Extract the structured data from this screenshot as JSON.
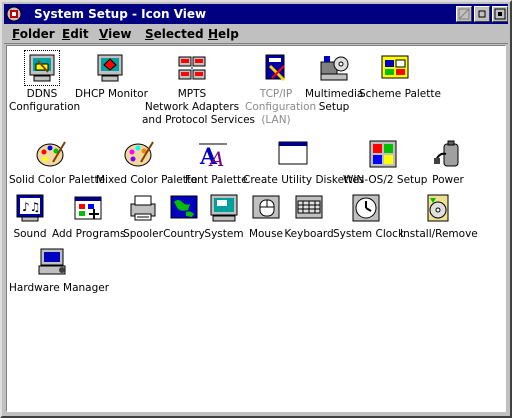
{
  "window": {
    "title": "System Setup - Icon View"
  },
  "menu": [
    "Folder",
    "Edit",
    "View",
    "Selected",
    "Help"
  ],
  "icons": [
    {
      "label": "DDNS\nConfiguration",
      "icon": "ddns-icon"
    },
    {
      "label": "DHCP Monitor",
      "icon": "dhcp-monitor-icon"
    },
    {
      "label": "MPTS\nNetwork Adapters\nand Protocol Services",
      "icon": "mpts-icon"
    },
    {
      "label": "TCP/IP\nConfiguration\n(LAN)",
      "icon": "tcpip-icon"
    },
    {
      "label": "Multimedia\nSetup",
      "icon": "multimedia-icon"
    },
    {
      "label": "Scheme Palette",
      "icon": "scheme-palette-icon"
    },
    {
      "label": "Solid Color Palette",
      "icon": "solid-color-palette-icon"
    },
    {
      "label": "Mixed Color Palette",
      "icon": "mixed-color-palette-icon"
    },
    {
      "label": "Font Palette",
      "icon": "font-palette-icon"
    },
    {
      "label": "Create Utility Diskettes",
      "icon": "diskettes-icon"
    },
    {
      "label": "WIN-OS/2 Setup",
      "icon": "win-os2-icon"
    },
    {
      "label": "Power",
      "icon": "power-icon"
    },
    {
      "label": "Sound",
      "icon": "sound-icon"
    },
    {
      "label": "Add Programs",
      "icon": "add-programs-icon"
    },
    {
      "label": "Spooler",
      "icon": "spooler-icon"
    },
    {
      "label": "Country",
      "icon": "country-icon"
    },
    {
      "label": "System",
      "icon": "system-icon"
    },
    {
      "label": "Mouse",
      "icon": "mouse-icon"
    },
    {
      "label": "Keyboard",
      "icon": "keyboard-icon"
    },
    {
      "label": "System Clock",
      "icon": "clock-icon"
    },
    {
      "label": "Install/Remove",
      "icon": "install-remove-icon"
    },
    {
      "label": "Hardware Manager",
      "icon": "hardware-manager-icon"
    }
  ],
  "colors": {
    "titlebar": "#000080",
    "client_bg": "#ffffff",
    "chrome": "#c0c0c0"
  }
}
